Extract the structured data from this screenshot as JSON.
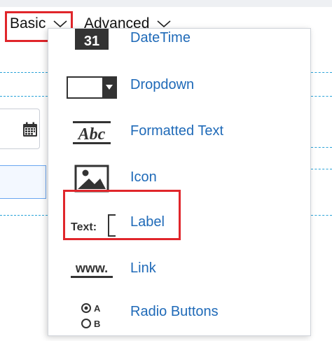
{
  "tabs": {
    "basic": "Basic",
    "advanced": "Advanced"
  },
  "menu": {
    "items": [
      {
        "label": "DateTime",
        "icon": "calendar-31-icon",
        "icon_text": "31"
      },
      {
        "label": "Dropdown",
        "icon": "dropdown-control-icon"
      },
      {
        "label": "Formatted Text",
        "icon": "formatted-text-abc-icon",
        "icon_text": "Abc"
      },
      {
        "label": "Icon",
        "icon": "image-icon"
      },
      {
        "label": "Label",
        "icon": "text-label-icon",
        "icon_text": "Text:"
      },
      {
        "label": "Link",
        "icon": "www-link-icon",
        "icon_text": "www."
      },
      {
        "label": "Radio Buttons",
        "icon": "radio-buttons-icon",
        "icon_text_a": "A",
        "icon_text_b": "B"
      }
    ]
  },
  "colors": {
    "link_blue": "#1f6ab8",
    "highlight_red": "#e0262b",
    "guide_blue": "#2aa3d8"
  }
}
